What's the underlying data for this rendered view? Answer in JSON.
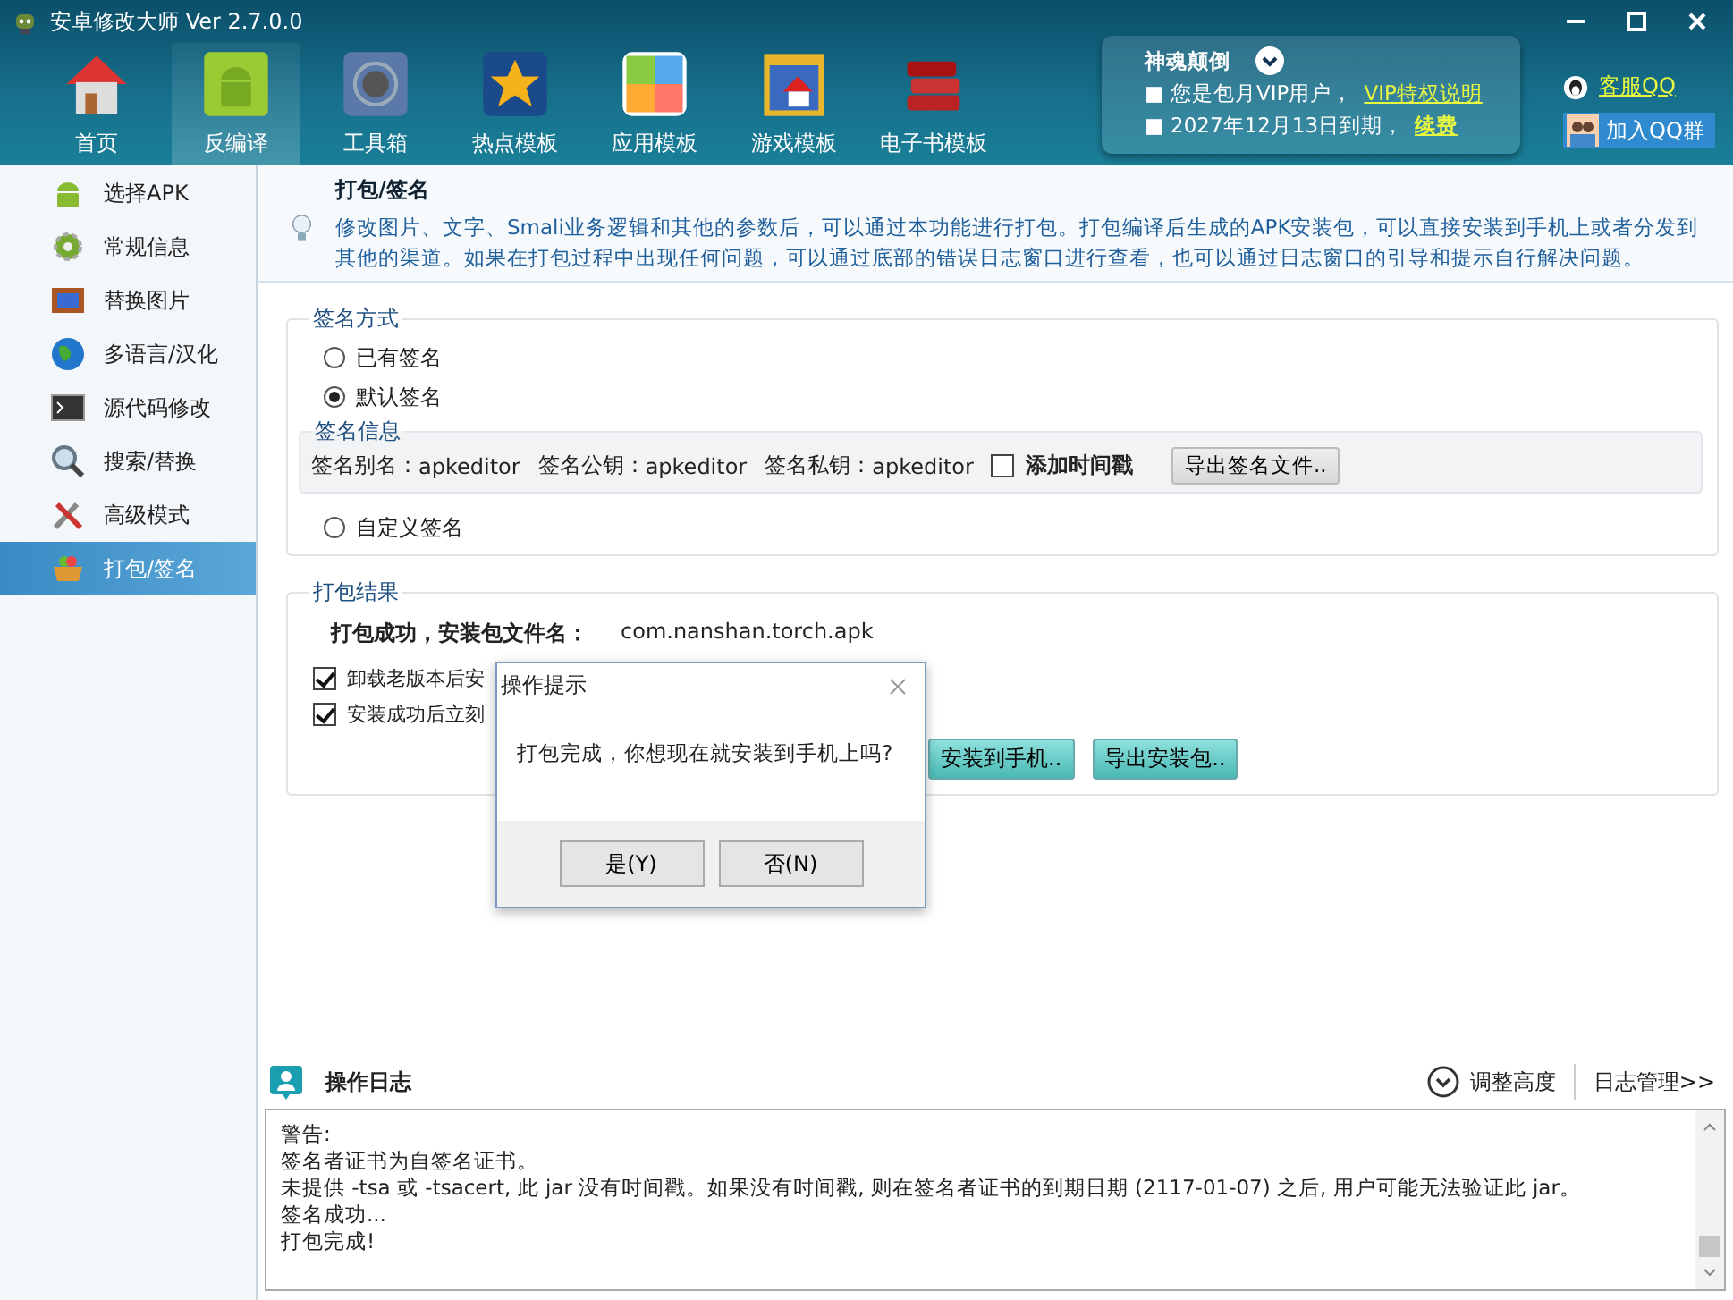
{
  "window": {
    "title": "安卓修改大师 Ver 2.7.0.0"
  },
  "toolbar": [
    {
      "label": "首页",
      "selected": false
    },
    {
      "label": "反编译",
      "selected": true
    },
    {
      "label": "工具箱",
      "selected": false
    },
    {
      "label": "热点模板",
      "selected": false
    },
    {
      "label": "应用模板",
      "selected": false
    },
    {
      "label": "游戏模板",
      "selected": false
    },
    {
      "label": "电子书模板",
      "selected": false
    }
  ],
  "vip_panel": {
    "title": "神魂颠倒",
    "line_1": "■ 您是包月VIP用户，",
    "link_1": "VIP特权说明",
    "line_2": "■ 2027年12月13日到期，",
    "link_2": "续费"
  },
  "service_link": "客服QQ",
  "qq_group_button": "加入QQ群",
  "sidebar": {
    "items": [
      {
        "label": "选择APK",
        "selected": false
      },
      {
        "label": "常规信息",
        "selected": false
      },
      {
        "label": "替换图片",
        "selected": false
      },
      {
        "label": "多语言/汉化",
        "selected": false
      },
      {
        "label": "源代码修改",
        "selected": false
      },
      {
        "label": "搜索/替换",
        "selected": false
      },
      {
        "label": "高级模式",
        "selected": false
      },
      {
        "label": "打包/签名",
        "selected": true
      }
    ]
  },
  "page_header": {
    "title": "打包/签名",
    "description": "修改图片、文字、Smali业务逻辑和其他的参数后，可以通过本功能进行打包。打包编译后生成的APK安装包，可以直接安装到手机上或者分发到其他的渠道。如果在打包过程中出现任何问题，可以通过底部的错误日志窗口进行查看，也可以通过日志窗口的引导和提示自行解决问题。"
  },
  "sign_method": {
    "legend": "签名方式",
    "options": [
      {
        "label": "已有签名",
        "selected": false
      },
      {
        "label": "默认签名",
        "selected": true,
        "details": {
          "legend": "签名信息",
          "fields": [
            {
              "label": "签名别名：",
              "value": "apkeditor"
            },
            {
              "label": "签名公钥：",
              "value": "apkeditor"
            },
            {
              "label": "签名私钥：",
              "value": "apkeditor"
            }
          ],
          "timestamp": {
            "label": "添加时间戳",
            "checked": false
          },
          "export_button": "导出签名文件.."
        }
      },
      {
        "label": "自定义签名",
        "selected": false
      }
    ]
  },
  "result": {
    "legend": "打包结果",
    "summary_label": "打包成功，安装包文件名：",
    "file_name": "com.nanshan.torch.apk",
    "options": [
      {
        "label": "卸载老版本后安",
        "checked": true
      },
      {
        "label": "安装成功后立刻",
        "checked": true
      }
    ],
    "buttons": [
      "安装到手机..",
      "导出安装包.."
    ]
  },
  "dialog": {
    "title": "操作提示",
    "message": "打包完成，你想现在就安装到手机上吗?",
    "buttons": [
      "是(Y)",
      "否(N)"
    ]
  },
  "log": {
    "title": "操作日志",
    "adjust_label": "调整高度",
    "manage_label": "日志管理>>",
    "lines": [
      "警告:",
      "签名者证书为自签名证书。",
      "未提供 -tsa 或 -tsacert, 此 jar 没有时间戳。如果没有时间戳, 则在签名者证书的到期日期 (2117-01-07) 之后, 用户可能无法验证此 jar。",
      "签名成功...",
      "打包完成!"
    ]
  }
}
